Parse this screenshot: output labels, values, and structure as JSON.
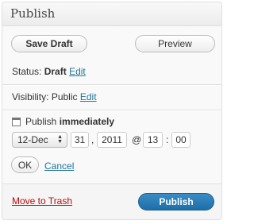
{
  "panel": {
    "title": "Publish"
  },
  "actions": {
    "save_draft": "Save Draft",
    "preview": "Preview"
  },
  "status": {
    "label": "Status:",
    "value": "Draft",
    "edit": "Edit"
  },
  "visibility": {
    "label": "Visibility:",
    "value": "Public",
    "edit": "Edit"
  },
  "schedule": {
    "label": "Publish",
    "value": "immediately",
    "month": "12-Dec",
    "day": "31",
    "comma": ",",
    "year": "2011",
    "at": "@",
    "hour": "13",
    "colon": ":",
    "minute": "00",
    "ok": "OK",
    "cancel": "Cancel"
  },
  "footer": {
    "trash": "Move to Trash",
    "publish": "Publish"
  },
  "colors": {
    "link": "#21759b",
    "trash": "#bc0b0b",
    "publish": "#2a7fb8"
  }
}
